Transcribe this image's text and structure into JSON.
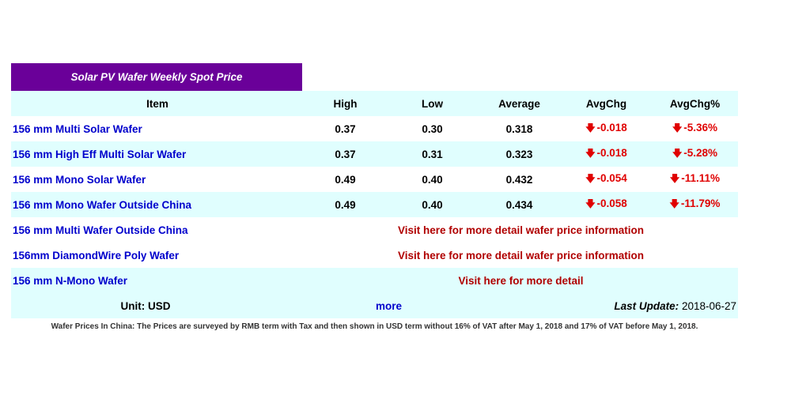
{
  "title": "Solar PV Wafer Weekly Spot Price",
  "headers": {
    "item": "Item",
    "high": "High",
    "low": "Low",
    "average": "Average",
    "avgchg": "AvgChg",
    "avgchg_pct": "AvgChg%"
  },
  "rows": [
    {
      "item": "156 mm Multi Solar Wafer",
      "high": "0.37",
      "low": "0.30",
      "average": "0.318",
      "avgchg": "-0.018",
      "avgchg_pct": "-5.36%"
    },
    {
      "item": "156 mm High Eff Multi Solar Wafer",
      "high": "0.37",
      "low": "0.31",
      "average": "0.323",
      "avgchg": "-0.018",
      "avgchg_pct": "-5.28%"
    },
    {
      "item": "156 mm Mono Solar Wafer",
      "high": "0.49",
      "low": "0.40",
      "average": "0.432",
      "avgchg": "-0.054",
      "avgchg_pct": "-11.11%"
    },
    {
      "item": "156 mm Mono Wafer Outside China",
      "high": "0.49",
      "low": "0.40",
      "average": "0.434",
      "avgchg": "-0.058",
      "avgchg_pct": "-11.79%"
    }
  ],
  "link_rows": [
    {
      "item": "156 mm Multi Wafer Outside China",
      "link": "Visit here for more detail wafer price information"
    },
    {
      "item": "156mm DiamondWire Poly Wafer",
      "link": "Visit here for more detail wafer price information"
    },
    {
      "item": "156 mm N-Mono Wafer",
      "link": "Visit here for more detail"
    }
  ],
  "footer": {
    "unit": "Unit: USD",
    "more": "more",
    "last_update_label": "Last Update:",
    "last_update_date": "2018-06-27"
  },
  "note": "Wafer Prices In China: The Prices are surveyed by RMB term with Tax and then shown in USD term without 16% of VAT after May 1, 2018 and 17% of VAT before May 1, 2018.",
  "icons": {
    "down_arrow": "down-arrow-icon"
  },
  "colors": {
    "title_bg": "#6a0099",
    "alt_row": "#e0fefe",
    "item_blue": "#0000cc",
    "negative_red": "#e00000",
    "link_red": "#b00000"
  }
}
